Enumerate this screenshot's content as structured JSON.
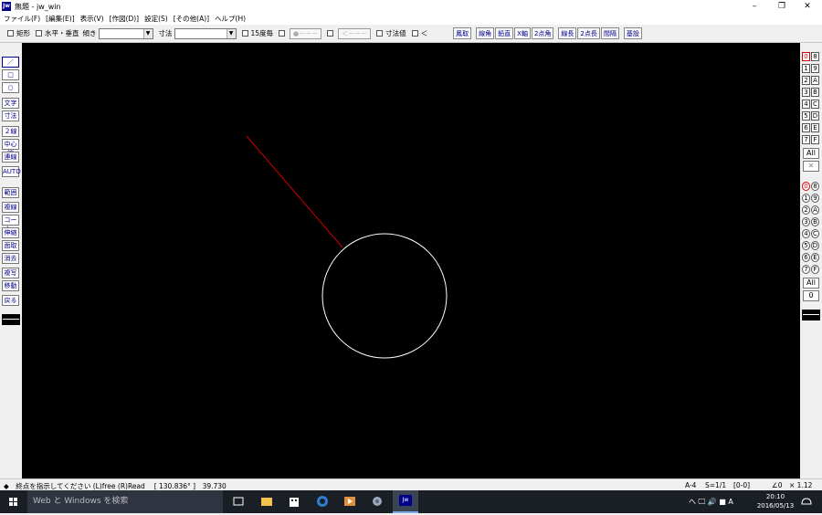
{
  "window": {
    "title": "無題 - jw_win",
    "app_icon_text": "Jw",
    "minimize": "–",
    "maximize": "❐",
    "close": "✕"
  },
  "menu": [
    "ファイル(F)",
    "[編集(E)]",
    "表示(V)",
    "[作図(D)]",
    "設定(S)",
    "[その他(A)]",
    "ヘルプ(H)"
  ],
  "toolbar": {
    "rect_label": "矩形",
    "hv_label": "水平・垂直",
    "slope_label": "傾き",
    "dim_label": "寸法",
    "deg15_label": "15度毎",
    "gray1": "●－－－",
    "gray2": "＜－－－",
    "dimval_label": "寸法値",
    "arrow_label": "＜",
    "buttons": [
      "鳳取",
      "線角",
      "鉛直",
      "X軸",
      "2点角",
      "線長",
      "2点長",
      "間隔",
      "基設"
    ]
  },
  "left_tools": [
    "／",
    "□",
    "○",
    "文字",
    "寸法",
    "２線",
    "中心線",
    "連線",
    "AUTO",
    "範囲",
    "複線",
    "コーナー",
    "伸縮",
    "面取",
    "消去",
    "複写",
    "移動",
    "戻る"
  ],
  "right_layers": {
    "group1": [
      "0",
      "8",
      "1",
      "9",
      "2",
      "A",
      "3",
      "B",
      "4",
      "C",
      "5",
      "D",
      "6",
      "E",
      "7",
      "F"
    ],
    "all1": "All",
    "x1": "✕",
    "group2": [
      "0",
      "8",
      "1",
      "9",
      "2",
      "A",
      "3",
      "B",
      "4",
      "C",
      "5",
      "D",
      "6",
      "E",
      "7",
      "F"
    ],
    "all2": "All",
    "zero": "0"
  },
  "status": {
    "message": "◆　終点を指示してください (L)free (R)Read 　[ 130.836° ]　39.730",
    "paper": "A-4",
    "scale": "S=1/1",
    "layer": "[0-0]",
    "angle": "∠0",
    "zoom": "× 1.12"
  },
  "taskbar": {
    "search_placeholder": "Web と Windows を検索",
    "tray_text": "へ 🖵 🔊 ■ A",
    "time": "20:10",
    "date": "2016/05/13"
  },
  "colors": {
    "canvas": "#000000",
    "line": "#d00000",
    "circle": "#ffffff"
  }
}
